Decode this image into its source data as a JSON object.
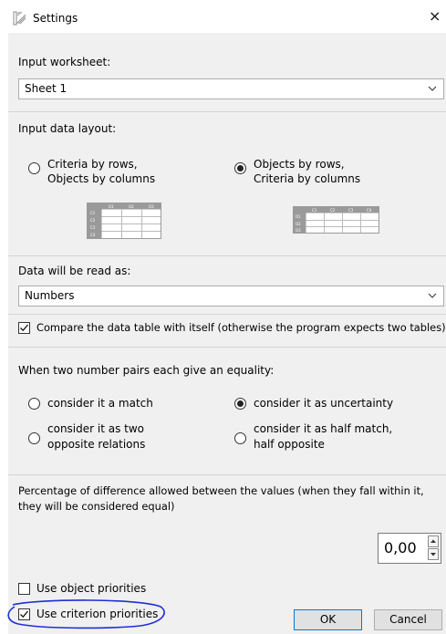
{
  "window": {
    "title": "Settings",
    "close_glyph": "×"
  },
  "input_worksheet": {
    "label": "Input worksheet:",
    "value": "Sheet 1"
  },
  "layout": {
    "label": "Input data layout:",
    "option_a": {
      "line1": "Criteria by rows,",
      "line2": "Objects by columns",
      "selected": false
    },
    "option_b": {
      "line1": "Objects by rows,",
      "line2": "Criteria by columns",
      "selected": true
    }
  },
  "read_as": {
    "label": "Data will be read as:",
    "value": "Numbers"
  },
  "compare_self": {
    "label": "Compare the data table with itself (otherwise the program expects two tables)",
    "checked": true
  },
  "equality": {
    "label": "When two number pairs each give an equality:",
    "opt1": "consider it a match",
    "opt2": "consider it as uncertainty",
    "opt3_line1": "consider it as two",
    "opt3_line2": "opposite relations",
    "opt4_line1": "consider it as half match,",
    "opt4_line2": "half opposite",
    "selected": "opt2"
  },
  "percentage": {
    "line1": "Percentage of difference allowed between the values (when they fall within it,",
    "line2": "they will be considered equal)",
    "value": "0,00"
  },
  "use_object_priorities": {
    "label": "Use object priorities",
    "checked": false
  },
  "use_criterion_priorities": {
    "label": "Use criterion priorities",
    "checked": true
  },
  "buttons": {
    "ok": "OK",
    "cancel": "Cancel"
  },
  "table_a": {
    "cols": [
      "O1",
      "O2",
      "O3"
    ],
    "rows": [
      "C1",
      "C2",
      "C3",
      "C4"
    ]
  },
  "table_b": {
    "cols": [
      "C1",
      "C2",
      "C3",
      "C4"
    ],
    "rows": [
      "O1",
      "O2",
      "O3"
    ]
  },
  "colors": {
    "panel": "#f0f0f0",
    "accent": "#0078d7",
    "annotation": "#1f2fd6"
  },
  "icons": {
    "title": "settings-app-icon",
    "chevron": "chevron-down-icon",
    "check": "check-icon"
  }
}
